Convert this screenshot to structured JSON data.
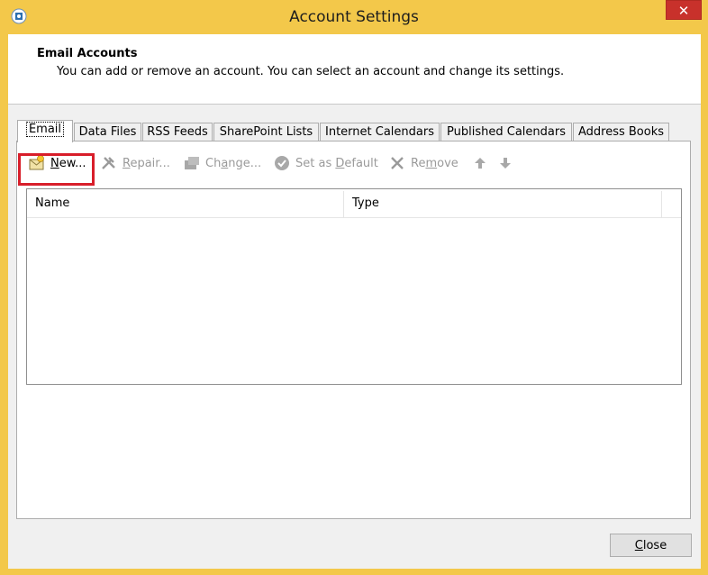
{
  "window": {
    "title": "Account Settings",
    "close_glyph": "✕",
    "app_icon": "outlook-icon"
  },
  "header": {
    "title": "Email Accounts",
    "description": "You can add or remove an account. You can select an account and change its settings."
  },
  "tabs": [
    {
      "label": "Email",
      "active": true
    },
    {
      "label": "Data Files"
    },
    {
      "label": "RSS Feeds"
    },
    {
      "label": "SharePoint Lists"
    },
    {
      "label": "Internet Calendars"
    },
    {
      "label": "Published Calendars"
    },
    {
      "label": "Address Books"
    }
  ],
  "toolbar": {
    "new": {
      "pre": "",
      "key": "N",
      "post": "ew...",
      "icon": "new-account-icon",
      "enabled": true
    },
    "repair": {
      "pre": "",
      "key": "R",
      "post": "epair...",
      "icon": "repair-icon",
      "enabled": false
    },
    "change": {
      "pre": "Ch",
      "key": "a",
      "post": "nge...",
      "icon": "change-icon",
      "enabled": false
    },
    "set_default": {
      "pre": "Set as ",
      "key": "D",
      "post": "efault",
      "icon": "checkmark-icon",
      "enabled": false
    },
    "remove": {
      "pre": "Re",
      "key": "m",
      "post": "ove",
      "icon": "remove-icon",
      "enabled": false
    },
    "move_up_icon": "arrow-up-icon",
    "move_down_icon": "arrow-down-icon",
    "disabled_color": "#9a9a9a",
    "highlight_color": "#d81e2a"
  },
  "list": {
    "columns": [
      "Name",
      "Type"
    ],
    "rows": []
  },
  "footer": {
    "close": {
      "key": "C",
      "post": "lose"
    }
  }
}
